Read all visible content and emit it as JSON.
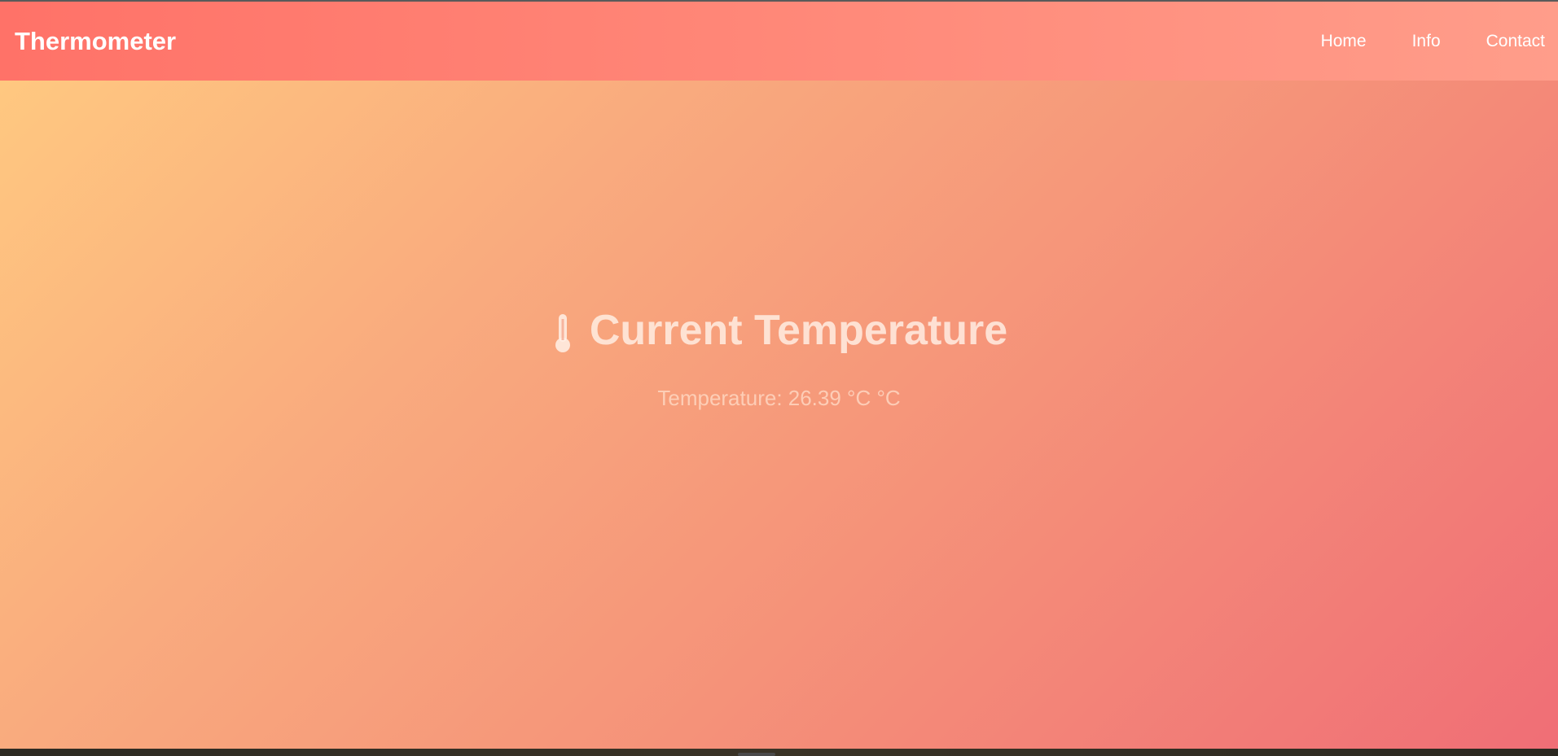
{
  "navbar": {
    "brand": "Thermometer",
    "links": [
      {
        "label": "Home"
      },
      {
        "label": "Info"
      },
      {
        "label": "Contact"
      }
    ]
  },
  "main": {
    "heading": "Current Temperature",
    "heading_icon": "thermometer-icon",
    "temperature_text": "Temperature: 26.39 °C °C"
  },
  "colors": {
    "navbar_start": "#ff7268",
    "navbar_end": "#ff9d8a",
    "background_start": "#ffc880",
    "background_end": "#f06e76",
    "text": "#ffffff"
  }
}
